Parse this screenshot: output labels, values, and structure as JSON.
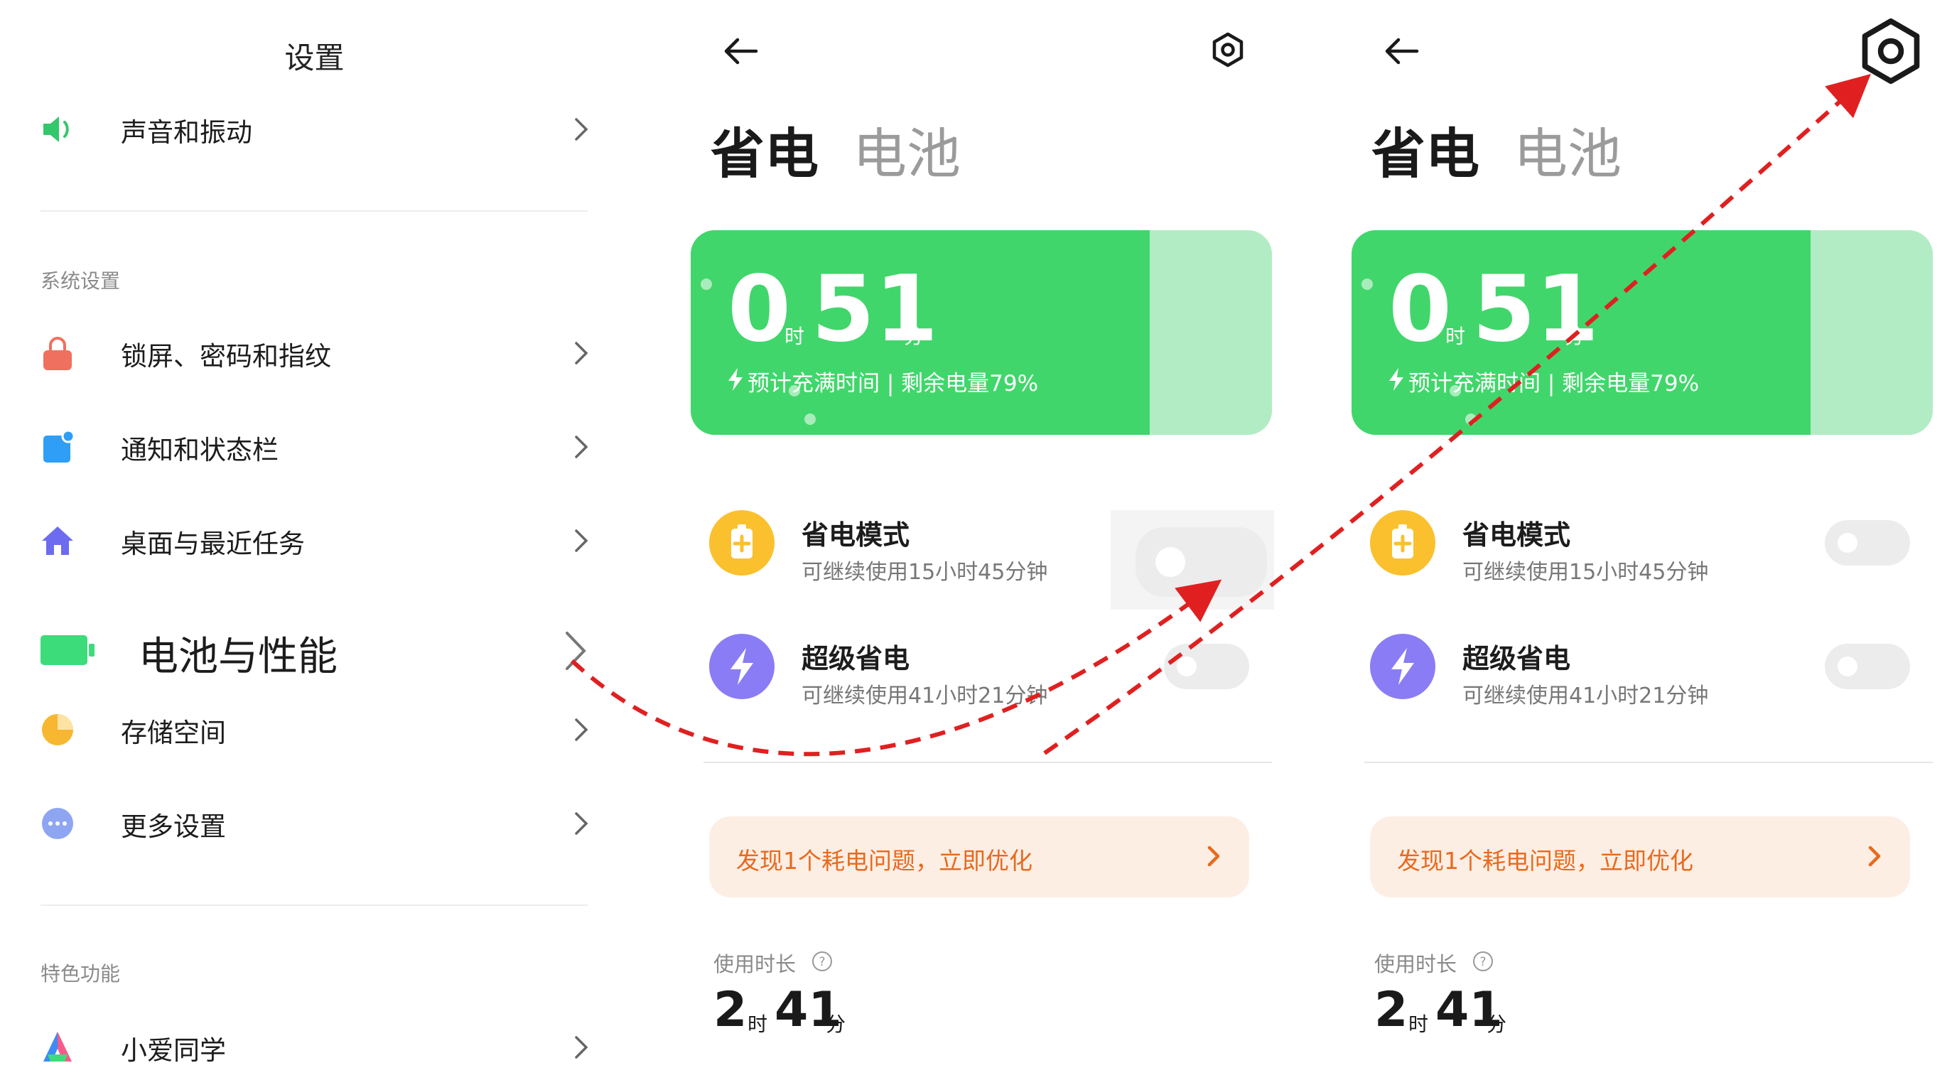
{
  "settings": {
    "title": "设置",
    "items_top": [
      {
        "label": "声音和振动",
        "icon": "speaker-icon",
        "color": "#35c76c"
      }
    ],
    "section_system": "系统设置",
    "items_system": [
      {
        "label": "锁屏、密码和指纹",
        "icon": "lock-icon",
        "color": "#f0705f"
      },
      {
        "label": "通知和状态栏",
        "icon": "notification-icon",
        "color": "#2e9ef7"
      },
      {
        "label": "桌面与最近任务",
        "icon": "home-icon",
        "color": "#6d6bf0"
      }
    ],
    "highlighted_item": {
      "label": "电池与性能",
      "icon": "battery-icon",
      "color": "#3ddc7a"
    },
    "items_more": [
      {
        "label": "存储空间",
        "icon": "pie-chart-icon",
        "color": "#f7b731"
      },
      {
        "label": "更多设置",
        "icon": "more-icon",
        "color": "#8ea6f2"
      }
    ],
    "section_features": "特色功能",
    "items_features": [
      {
        "label": "小爱同学",
        "icon": "xiaoai-icon"
      }
    ]
  },
  "battery_page": {
    "tab_active": "省电",
    "tab_inactive": "电池",
    "charge_time": {
      "hours": "0",
      "hours_unit": "时",
      "minutes": "51",
      "minutes_unit": "分"
    },
    "charge_info": "预计充满时间 | 剩余电量79%",
    "battery_level": 0.79,
    "modes": [
      {
        "title": "省电模式",
        "subtitle": "可继续使用15小时45分钟",
        "icon": "battery-plus-icon",
        "color": "#fbc02d",
        "enabled": false
      },
      {
        "title": "超级省电",
        "subtitle": "可继续使用41小时21分钟",
        "icon": "lightning-icon",
        "color": "#8a7cf5",
        "enabled": false
      }
    ],
    "alert": "发现1个耗电问题，立即优化",
    "usage": {
      "label": "使用时长",
      "hours": "2",
      "hours_unit": "时",
      "minutes": "41",
      "minutes_unit": "分"
    }
  },
  "colors": {
    "accent_green": "#41d66b",
    "battery_track": "#b2ecc4",
    "annotation_arrow": "#e02020",
    "alert_text": "#e86a1e"
  }
}
